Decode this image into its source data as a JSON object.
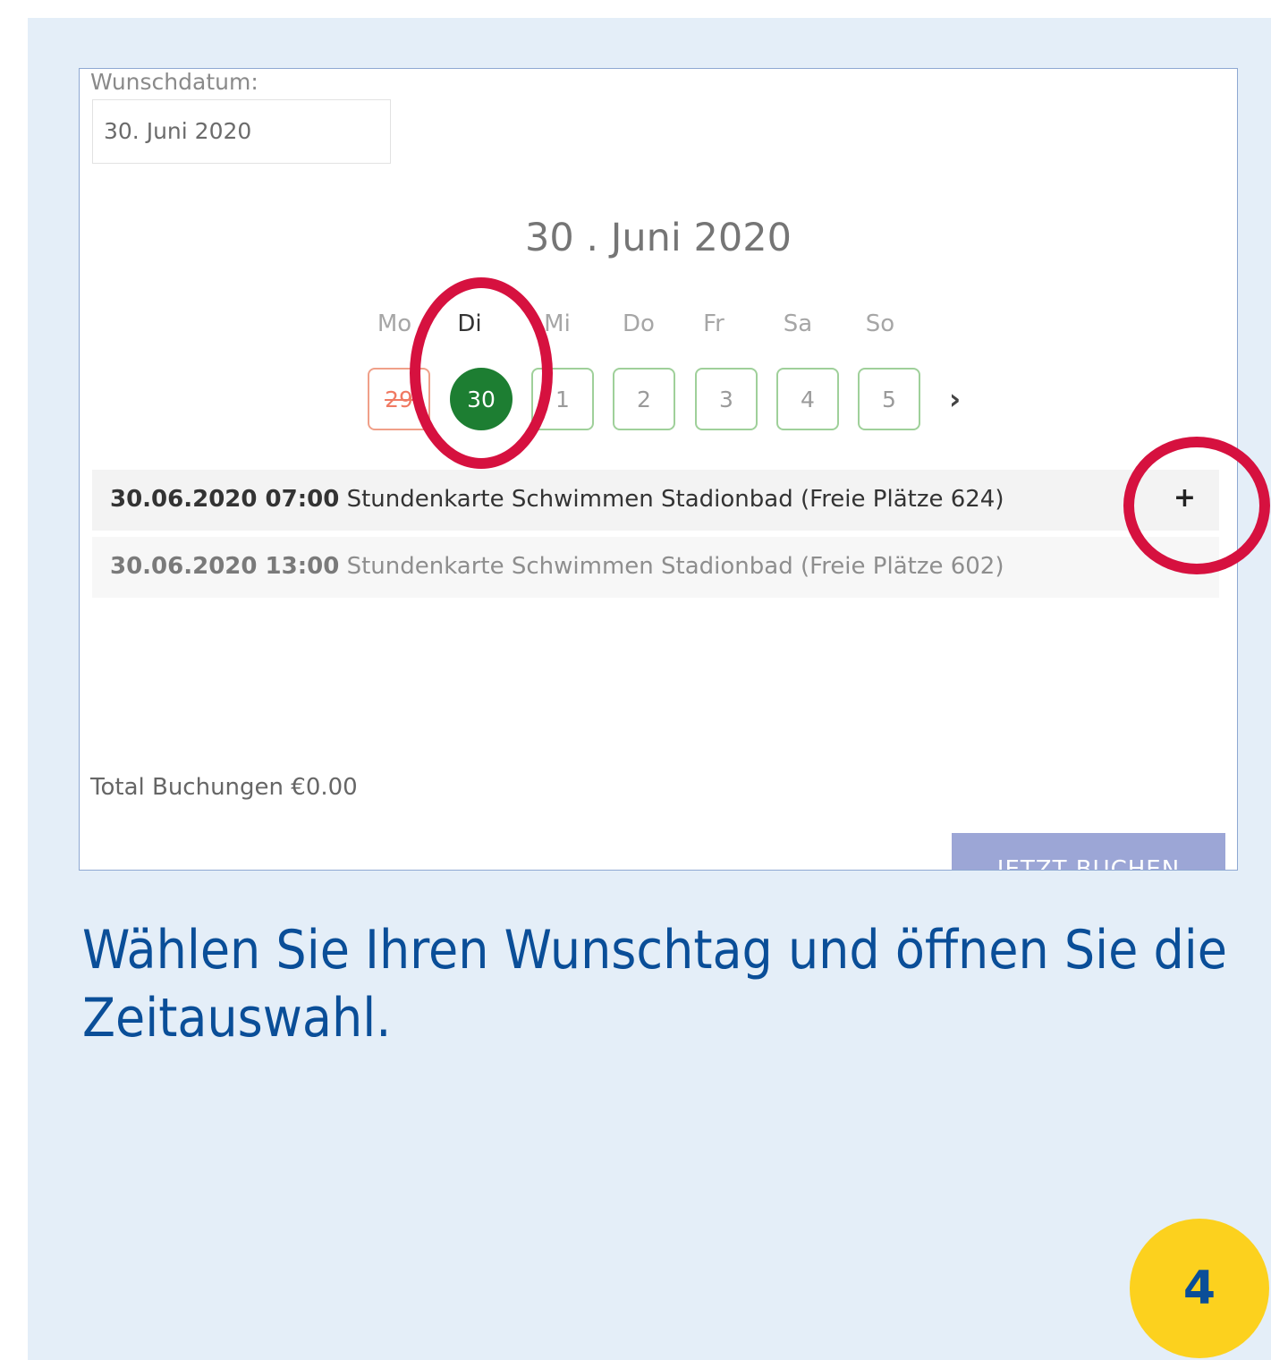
{
  "form": {
    "wish_label": "Wunschdatum:",
    "wish_value": "30. Juni 2020"
  },
  "calendar": {
    "title": "30 . Juni 2020",
    "weekdays": [
      "Mo",
      "Di",
      "Mi",
      "Do",
      "Fr",
      "Sa",
      "So"
    ],
    "days": [
      "29",
      "30",
      "1",
      "2",
      "3",
      "4",
      "5"
    ],
    "selected_day": "30",
    "disabled_day": "29",
    "next_icon": "chevron-right-icon"
  },
  "slots": [
    {
      "datetime": "30.06.2020 07:00",
      "description": "Stundenkarte Schwimmen Stadionbad (Freie Plätze 624)",
      "action": "+"
    },
    {
      "datetime": "30.06.2020 13:00",
      "description": "Stundenkarte Schwimmen Stadionbad (Freie Plätze 602)"
    }
  ],
  "total": "Total Buchungen €0.00",
  "book_button": "JETZT BUCHEN",
  "caption": "Wählen Sie Ihren Wunschtag und öffnen Sie die Zeitauswahl.",
  "step_number": "4",
  "colors": {
    "background": "#e4eef8",
    "accent_ring": "#d6113f",
    "selected_day": "#1d7e32",
    "caption_text": "#0a4e98",
    "badge": "#fcd11e"
  }
}
